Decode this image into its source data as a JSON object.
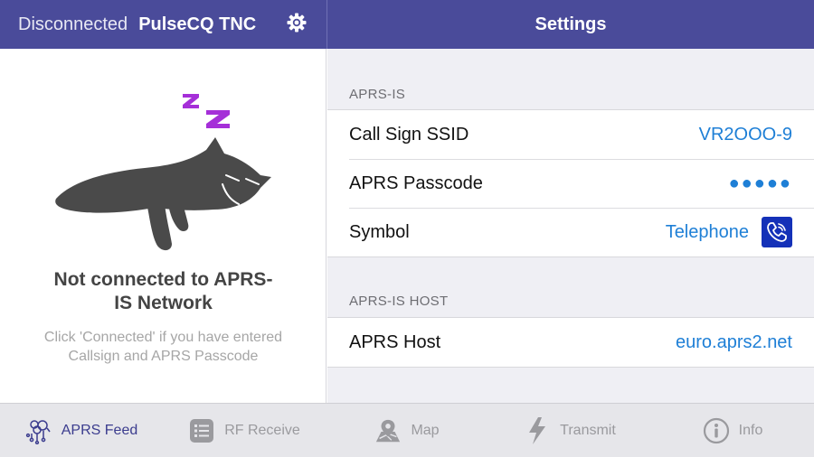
{
  "header": {
    "status": "Disconnected",
    "device": "PulseCQ TNC",
    "title": "Settings"
  },
  "left": {
    "sleep_mark": "z z",
    "message_title": "Not connected to APRS-IS Network",
    "message_hint": "Click 'Connected' if you have entered Callsign and APRS Passcode"
  },
  "settings": {
    "section1": {
      "header": "APRS-IS",
      "rows": [
        {
          "label": "Call Sign SSID",
          "value": "VR2OOO-9"
        },
        {
          "label": "APRS Passcode",
          "value": "●●●●●"
        },
        {
          "label": "Symbol",
          "value": "Telephone"
        }
      ]
    },
    "section2": {
      "header": "APRS-IS HOST",
      "rows": [
        {
          "label": "APRS Host",
          "value": "euro.aprs2.net"
        }
      ]
    }
  },
  "tabs": [
    {
      "label": "APRS Feed",
      "icon": "network-icon",
      "active": true
    },
    {
      "label": "RF Receive",
      "icon": "list-icon",
      "active": false
    },
    {
      "label": "Map",
      "icon": "map-icon",
      "active": false
    },
    {
      "label": "Transmit",
      "icon": "lightning-icon",
      "active": false
    },
    {
      "label": "Info",
      "icon": "info-icon",
      "active": false
    }
  ],
  "colors": {
    "header_bg": "#4a4b9a",
    "accent_blue": "#1e7fd6",
    "sleep_z": "#a52fd8",
    "cat": "#4a4a4a",
    "symbol_tile": "#1431b8"
  }
}
